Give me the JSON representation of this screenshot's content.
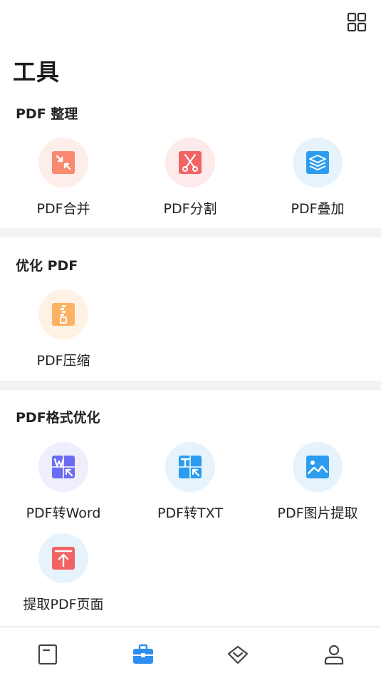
{
  "header": {
    "title": "工具",
    "grid_icon": "grid-view-icon"
  },
  "sections": [
    {
      "title": "PDF 整理",
      "tools": [
        {
          "label": "PDF合并",
          "icon": "merge-icon",
          "color": "#f98a6f",
          "bg": "#fdeeea"
        },
        {
          "label": "PDF分割",
          "icon": "scissors-icon",
          "color": "#f26464",
          "bg": "#fdeaea"
        },
        {
          "label": "PDF叠加",
          "icon": "layers-icon",
          "color": "#2c9cf0",
          "bg": "#e6f3fd"
        }
      ]
    },
    {
      "title": "优化 PDF",
      "tools": [
        {
          "label": "PDF压缩",
          "icon": "zip-icon",
          "color": "#fbb265",
          "bg": "#fff2e5"
        }
      ]
    },
    {
      "title": "PDF格式优化",
      "tools": [
        {
          "label": "PDF转Word",
          "icon": "word-convert-icon",
          "color": "#6c6cf3",
          "bg": "#eeeefd"
        },
        {
          "label": "PDF转TXT",
          "icon": "txt-convert-icon",
          "color": "#2c9cf0",
          "bg": "#e6f3fd"
        },
        {
          "label": "PDF图片提取",
          "icon": "image-extract-icon",
          "color": "#2c9cf0",
          "bg": "#e6f3fd"
        },
        {
          "label": "提取PDF页面",
          "icon": "page-extract-icon",
          "color": "#f26464",
          "bg": "#e6f3fd"
        }
      ]
    }
  ],
  "bottom_nav": [
    {
      "icon": "document-icon",
      "active": false
    },
    {
      "icon": "toolbox-icon",
      "active": true
    },
    {
      "icon": "diamond-icon",
      "active": false
    },
    {
      "icon": "user-icon",
      "active": false
    }
  ],
  "colors": {
    "accent": "#2c8ef0",
    "inactive": "#444444",
    "divider": "#f3f3f3"
  }
}
